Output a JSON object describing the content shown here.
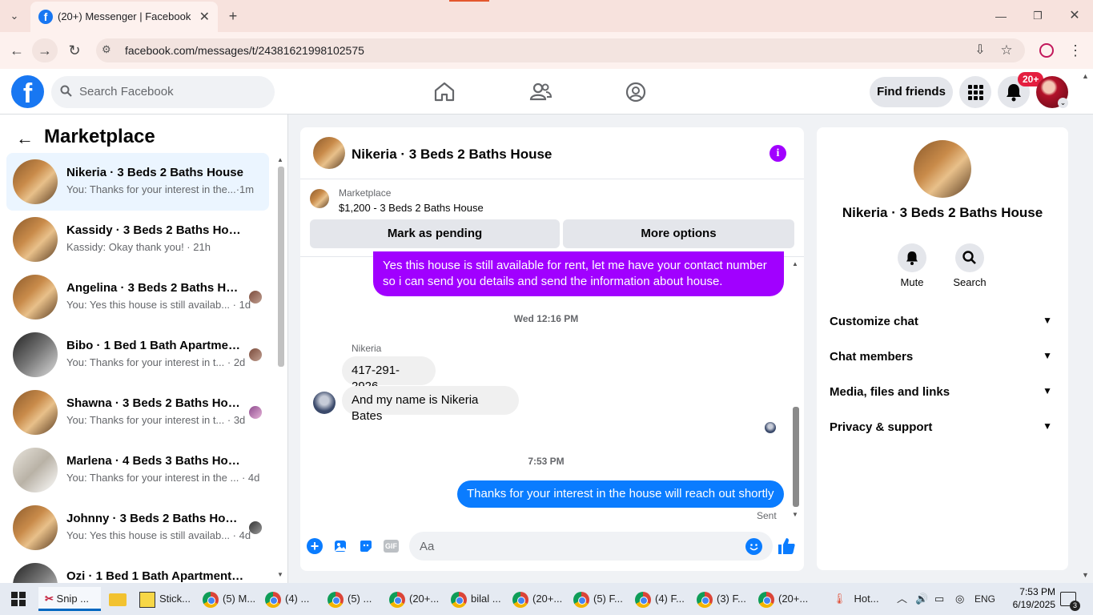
{
  "browser": {
    "tab_title": "(20+) Messenger | Facebook",
    "tab_close": "✕",
    "new_tab": "+",
    "url": "facebook.com/messages/t/24381621998102575"
  },
  "fb": {
    "logo": "f",
    "search_placeholder": "Search Facebook",
    "find_friends": "Find friends",
    "notifications_badge": "20+"
  },
  "marketplace": {
    "title": "Marketplace",
    "conversations": [
      {
        "name": "Nikeria · 3 Beds 2 Baths House",
        "preview": "You: Thanks for your interest in the...·1m"
      },
      {
        "name": "Kassidy · 3 Beds 2 Baths House",
        "preview": "Kassidy: Okay thank you! · 21h"
      },
      {
        "name": "Angelina · 3 Beds 2 Baths Hou...",
        "preview": "You: Yes this house is still availab... · 1d"
      },
      {
        "name": "Bibo · 1 Bed 1 Bath Apartment...",
        "preview": "You: Thanks for your interest in t... · 2d"
      },
      {
        "name": "Shawna · 3 Beds 2 Baths House",
        "preview": "You: Thanks for your interest in t... · 3d"
      },
      {
        "name": "Marlena · 4 Beds 3 Baths House",
        "preview": "You: Thanks for your interest in the ... · 4d"
      },
      {
        "name": "Johnny · 3 Beds 2 Baths House",
        "preview": "You: Yes this house is still availab... · 4d"
      },
      {
        "name": "Ozi · 1 Bed 1 Bath Apartment/...",
        "preview": ""
      }
    ]
  },
  "chat": {
    "title": "Nikeria · 3 Beds 2 Baths House",
    "listing_label": "Marketplace",
    "listing_detail": "$1,200 - 3 Beds 2 Baths House",
    "mark_pending": "Mark as pending",
    "more_options": "More options",
    "messages": {
      "m1": "Yes this house is still available for rent, let me have your contact number so i can send you details and send the information about house.",
      "ts1": "Wed 12:16 PM",
      "sender": "Nikeria",
      "m2": "417-291-2926",
      "m3": "And my name is Nikeria Bates",
      "ts2": "7:53 PM",
      "m4": "Thanks for your interest in the house will reach out shortly",
      "status": "Sent"
    },
    "composer_placeholder": "Aa"
  },
  "info": {
    "title": "Nikeria · 3 Beds 2 Baths House",
    "mute": "Mute",
    "search": "Search",
    "menu": [
      "Customize chat",
      "Chat members",
      "Media, files and links",
      "Privacy & support"
    ]
  },
  "taskbar": {
    "items": [
      "Snip ...",
      "",
      "Stick...",
      "(5) M...",
      "(4) ...",
      "(5) ...",
      "(20+...",
      "bilal ...",
      "(20+...",
      "(5) F...",
      "(4) F...",
      "(3) F...",
      "(20+..."
    ],
    "weather": "Hot...",
    "lang": "ENG",
    "time": "7:53 PM",
    "date": "6/19/2025",
    "notif_count": "3"
  },
  "colors": {
    "fb_blue": "#1877f2",
    "msg_blue": "#0a7cff",
    "msg_purple": "#a100ff",
    "badge_red": "#e41e3f"
  }
}
